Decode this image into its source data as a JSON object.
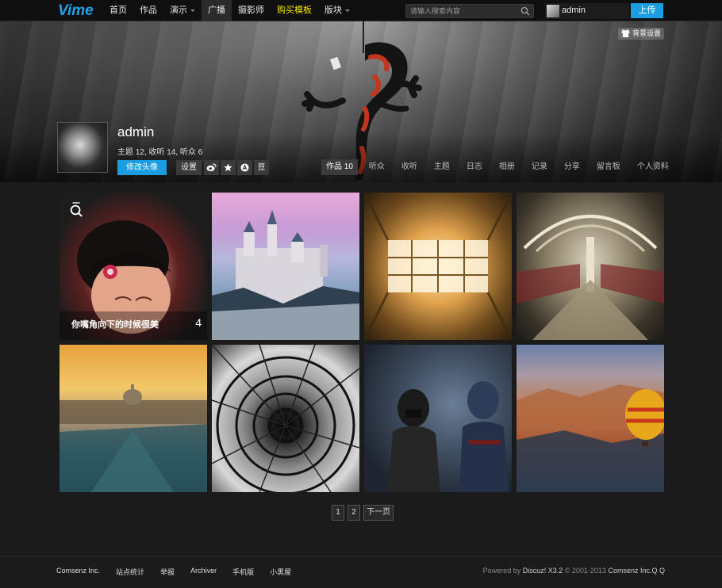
{
  "brand": {
    "logo": "Vime",
    "accent": "#1a9de1",
    "highlight": "#f2e600"
  },
  "nav": {
    "items": [
      {
        "label": "首页"
      },
      {
        "label": "作品"
      },
      {
        "label": "演示",
        "dropdown": true
      },
      {
        "label": "广播",
        "active": true
      },
      {
        "label": "摄影师"
      },
      {
        "label": "购买模板",
        "highlight": true
      },
      {
        "label": "版块",
        "dropdown": true
      }
    ]
  },
  "search": {
    "placeholder": "请输入搜索内容",
    "icon": "search-icon"
  },
  "user": {
    "name": "admin",
    "upload": "上传"
  },
  "banner": {
    "bg_setting": "背景设置"
  },
  "profile": {
    "name": "admin",
    "stats": "主题 12,   收听 14,   听众 6",
    "edit_avatar": "修改头像",
    "settings": "设置",
    "sns": [
      "weibo-icon",
      "star-icon",
      "a-icon",
      "douban-icon"
    ],
    "sns_douban": "豆",
    "tabs": [
      {
        "label": "作品 10",
        "active": true
      },
      {
        "label": "听众"
      },
      {
        "label": "收听"
      },
      {
        "label": "主题"
      },
      {
        "label": "日志"
      },
      {
        "label": "相册"
      },
      {
        "label": "记录"
      },
      {
        "label": "分享"
      },
      {
        "label": "留言板"
      },
      {
        "label": "个人资料"
      }
    ]
  },
  "gallery": {
    "featured": {
      "caption": "你嘴角向下的时候很美",
      "count": "4"
    },
    "tiles": [
      "portrait",
      "castle",
      "ceiling",
      "subway",
      "city-bridge",
      "spiral-stairs",
      "toy-figures",
      "balloon-valley"
    ]
  },
  "pager": {
    "pages": [
      "1",
      "2"
    ],
    "next": "下一页"
  },
  "footer": {
    "links": [
      "Comsenz Inc.",
      "站点统计",
      "举报",
      "Archiver",
      "手机版",
      "小黑屋"
    ],
    "powered": "Powered by",
    "product": "Discuz! X3.2",
    "copyright": "© 2001-2013",
    "company": "Comsenz Inc.",
    "qq": "Q Q"
  }
}
